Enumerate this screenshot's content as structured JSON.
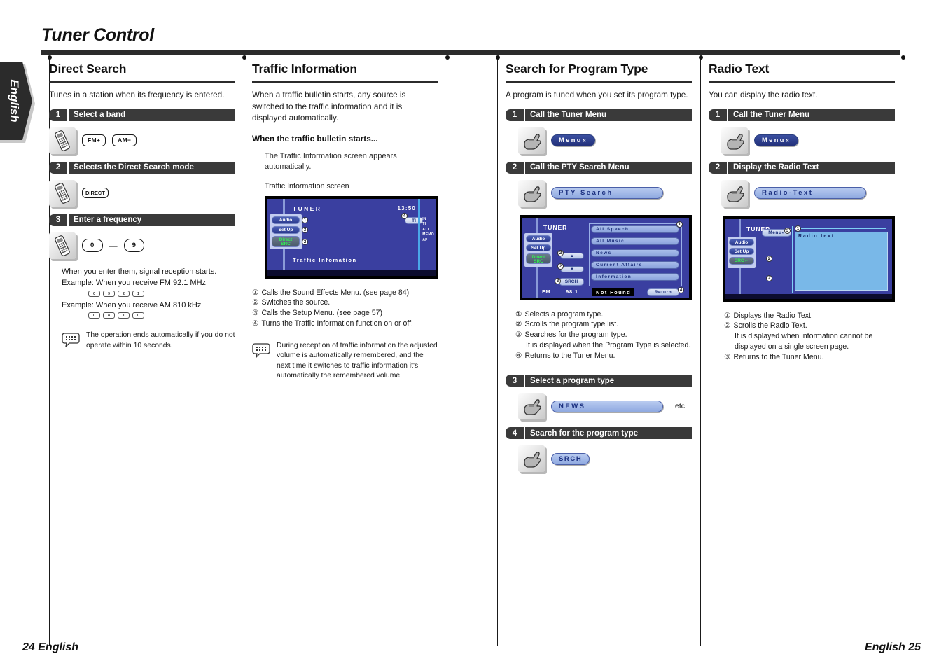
{
  "page": {
    "title": "Tuner Control",
    "side_tab": "English",
    "footer_left": "24 English",
    "footer_right": "English 25"
  },
  "col1": {
    "heading": "Direct Search",
    "intro": "Tunes in a station when its frequency is entered.",
    "step1": {
      "num": "1",
      "label": "Select a band"
    },
    "key_fm": "FM+",
    "key_am": "AM−",
    "step2": {
      "num": "2",
      "label": "Selects the Direct Search mode"
    },
    "key_direct": "DIRECT",
    "step3": {
      "num": "3",
      "label": "Enter a frequency"
    },
    "key_0": "0",
    "key_dash": "—",
    "key_9": "9",
    "note_line1": "When you enter them, signal reception starts.",
    "example_fm": "Example: When you receive FM 92.1 MHz",
    "example_fm_keys": [
      "0",
      "9",
      "2",
      "1"
    ],
    "example_am": "Example: When you receive AM 810 kHz",
    "example_am_keys": [
      "0",
      "8",
      "1",
      "0"
    ],
    "memo": "The operation ends automatically if you do not operate within 10 seconds."
  },
  "col2": {
    "heading": "Traffic Information",
    "intro": "When a traffic bulletin starts, any source is switched to the traffic information and it is displayed automatically.",
    "subhead": "When the traffic bulletin starts...",
    "indent_note": "The Traffic Information screen appears automatically.",
    "screen_caption": "Traffic Information screen",
    "screen": {
      "title": "TUNER",
      "time": "13:50",
      "btn_audio": "Audio",
      "btn_setup": "Set Up",
      "btn_src_line1": "Direct",
      "btn_src_line2": "SRC",
      "btn_ti": "TI",
      "tags": [
        "IN",
        "TI",
        "ATT",
        "MEMO",
        "AF"
      ],
      "status": "Traffic Infomation",
      "markers": [
        "1",
        "2",
        "3",
        "4"
      ]
    },
    "notes": [
      {
        "marker": "①",
        "text": "Calls the Sound Effects Menu. (see page 84)"
      },
      {
        "marker": "②",
        "text": "Switches the source."
      },
      {
        "marker": "③",
        "text": "Calls the Setup Menu. (see page 57)"
      },
      {
        "marker": "④",
        "text": "Turns the Traffic Information function on or off."
      }
    ],
    "memo": "During reception of traffic information the adjusted volume is automatically remembered, and the next time it switches to traffic information it's automatically the remembered volume."
  },
  "col3": {
    "heading": "Search for Program Type",
    "intro": "A program is tuned when you set its program type.",
    "step1": {
      "num": "1",
      "label": "Call the Tuner Menu"
    },
    "btn_menu": "Menu«",
    "step2": {
      "num": "2",
      "label": "Call the PTY Search Menu"
    },
    "btn_pty_search": "PTY Search",
    "screen": {
      "title": "TUNER",
      "btn_audio": "Audio",
      "btn_setup": "Set Up",
      "btn_src_line1": "Direct",
      "btn_src_line2": "SRC",
      "btn_srch": "SRCH",
      "btn_return": "Return",
      "arrow_up": "▲",
      "arrow_down": "▼",
      "pty_items": [
        "All Speech",
        "All Music",
        "News",
        "Current Affairs",
        "Information"
      ],
      "band": "FM",
      "frequency": "98.1",
      "status": "Not Found",
      "markers": [
        "1",
        "2",
        "2",
        "3",
        "4"
      ]
    },
    "notes": [
      {
        "marker": "①",
        "text": "Selects a program type."
      },
      {
        "marker": "②",
        "text": "Scrolls the program type list."
      },
      {
        "marker": "③",
        "text": "Searches for the program type.",
        "sub": "It is displayed when the Program Type is selected."
      },
      {
        "marker": "④",
        "text": "Returns to the Tuner Menu."
      }
    ],
    "step3": {
      "num": "3",
      "label": "Select a program type"
    },
    "btn_news": "NEWS",
    "etc": "etc.",
    "step4": {
      "num": "4",
      "label": "Search for the program type"
    },
    "btn_srch": "SRCH"
  },
  "col4": {
    "heading": "Radio Text",
    "intro": "You can display the radio text.",
    "step1": {
      "num": "1",
      "label": "Call the Tuner Menu"
    },
    "btn_menu": "Menu«",
    "step2": {
      "num": "2",
      "label": "Display the Radio Text"
    },
    "btn_radio_text": "Radio-Text",
    "screen": {
      "title": "TUNER",
      "btn_menu": "Menu«",
      "btn_audio": "Audio",
      "btn_setup": "Set Up",
      "btn_src": "SRC←",
      "radio_text_label": "Radio text:",
      "markers": [
        "1",
        "2",
        "2",
        "3"
      ]
    },
    "notes": [
      {
        "marker": "①",
        "text": "Displays the Radio Text."
      },
      {
        "marker": "②",
        "text": "Scrolls the Radio Text.",
        "sub": "It is displayed when information cannot be displayed on a single screen page."
      },
      {
        "marker": "③",
        "text": "Returns to the Tuner Menu."
      }
    ]
  }
}
